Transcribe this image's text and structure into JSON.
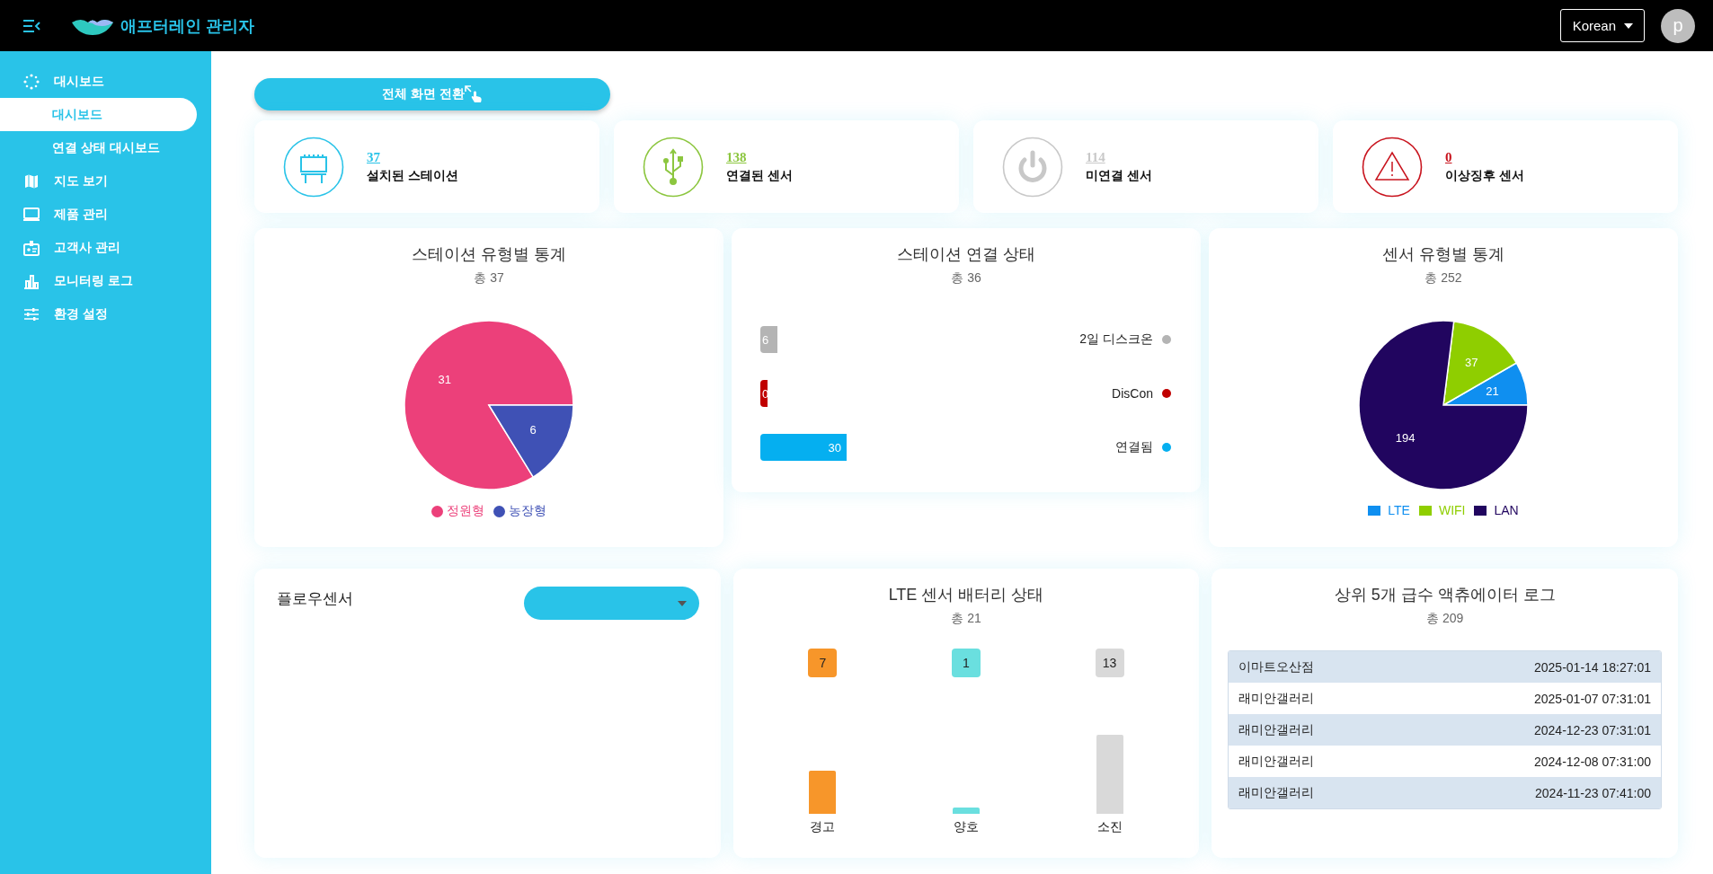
{
  "header": {
    "app_title": "애프터레인 관리자",
    "language": "Korean",
    "avatar_letter": "p"
  },
  "sidebar": {
    "items": [
      {
        "label": "대시보드",
        "selected": false,
        "children": [
          {
            "label": "대시보드",
            "selected": true
          },
          {
            "label": "연결 상태 대시보드",
            "selected": false
          }
        ]
      },
      {
        "label": "지도 보기",
        "selected": false
      },
      {
        "label": "제품 관리",
        "selected": false
      },
      {
        "label": "고객사 관리",
        "selected": false
      },
      {
        "label": "모니터링 로그",
        "selected": false
      },
      {
        "label": "환경 설정",
        "selected": false
      }
    ]
  },
  "fullscreen_button": {
    "label": "전체 화면 전환"
  },
  "stats": [
    {
      "kind": "station",
      "value": "37",
      "label": "설치된 스테이션",
      "color": "#29c3e8"
    },
    {
      "kind": "usb",
      "value": "138",
      "label": "연결된 센서",
      "color": "#8cc63f"
    },
    {
      "kind": "power",
      "value": "114",
      "label": "미연결 센서",
      "color": "#c8c8c8"
    },
    {
      "kind": "warning",
      "value": "0",
      "label": "이상징후 센서",
      "color": "#c8141e"
    }
  ],
  "station_type_chart": {
    "title": "스테이션 유형별 통계",
    "subtitle": "총 37",
    "chart_data": {
      "type": "pie",
      "categories": [
        "정원형",
        "농장형"
      ],
      "values": [
        31,
        6
      ],
      "colors": [
        "#ec407a",
        "#3f51b5"
      ],
      "data_labels": true
    }
  },
  "station_connection_chart": {
    "title": "스테이션 연결 상태",
    "subtitle": "총 36",
    "chart_data": {
      "type": "bar",
      "orientation": "horizontal",
      "categories": [
        "2일 디스크온",
        "DisCon",
        "연결됨"
      ],
      "values": [
        6,
        0,
        30
      ],
      "colors": [
        "#b4b4b4",
        "#c00000",
        "#05aff0"
      ],
      "data_labels": true
    }
  },
  "sensor_type_chart": {
    "title": "센서 유형별 통계",
    "subtitle": "총 252",
    "chart_data": {
      "type": "pie",
      "categories": [
        "LTE",
        "WIFI",
        "LAN"
      ],
      "values": [
        21,
        37,
        194
      ],
      "colors": [
        "#0f8ff0",
        "#8fce00",
        "#21055f"
      ],
      "data_labels": true
    }
  },
  "flow_sensor": {
    "title": "플로우센서"
  },
  "battery_chart": {
    "title": "LTE 센서 배터리 상태",
    "subtitle": "총 21",
    "chart_data": {
      "type": "bar",
      "categories": [
        "경고",
        "양호",
        "소진"
      ],
      "values": [
        7,
        1,
        13
      ],
      "colors": [
        "#f7962a",
        "#6adfdf",
        "#d9d9d9"
      ],
      "data_labels": true
    }
  },
  "actuator_log": {
    "title": "상위 5개 급수 액츄에이터 로그",
    "subtitle": "총 209",
    "rows": [
      {
        "name": "이마트오산점",
        "time": "2025-01-14 18:27:01"
      },
      {
        "name": "래미안갤러리",
        "time": "2025-01-07 07:31:01"
      },
      {
        "name": "래미안갤러리",
        "time": "2024-12-23 07:31:01"
      },
      {
        "name": "래미안갤러리",
        "time": "2024-12-08 07:31:00"
      },
      {
        "name": "래미안갤러리",
        "time": "2024-11-23 07:41:00"
      }
    ]
  }
}
